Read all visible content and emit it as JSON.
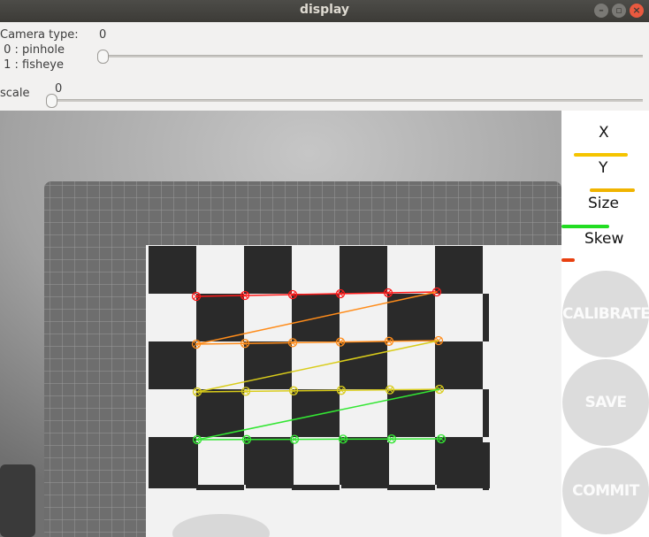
{
  "window": {
    "title": "display"
  },
  "controls": {
    "camera_type": {
      "label": "Camera type:",
      "options_text": " 0 : pinhole\n 1 : fisheye",
      "value": "0",
      "level": 0
    },
    "scale": {
      "label": "scale",
      "value": "0",
      "level": 0
    }
  },
  "sidebar": {
    "metrics": [
      {
        "label": "X",
        "level": 0.62,
        "color": "#f5c400"
      },
      {
        "label": "Y",
        "level": 0.52,
        "color": "#f0b400"
      },
      {
        "label": "Size",
        "level": 0.55,
        "color": "#22dd22"
      },
      {
        "label": "Skew",
        "level": 0.15,
        "color": "#e84010"
      }
    ],
    "buttons": {
      "calibrate": "CALIBRATE",
      "save": "SAVE",
      "commit": "COMMIT"
    }
  },
  "colors": {
    "row1": "#ff1a1a",
    "row2": "#ff8c1a",
    "row3": "#d9cc1a",
    "row4": "#33e633",
    "button": "#dcdcdc"
  }
}
